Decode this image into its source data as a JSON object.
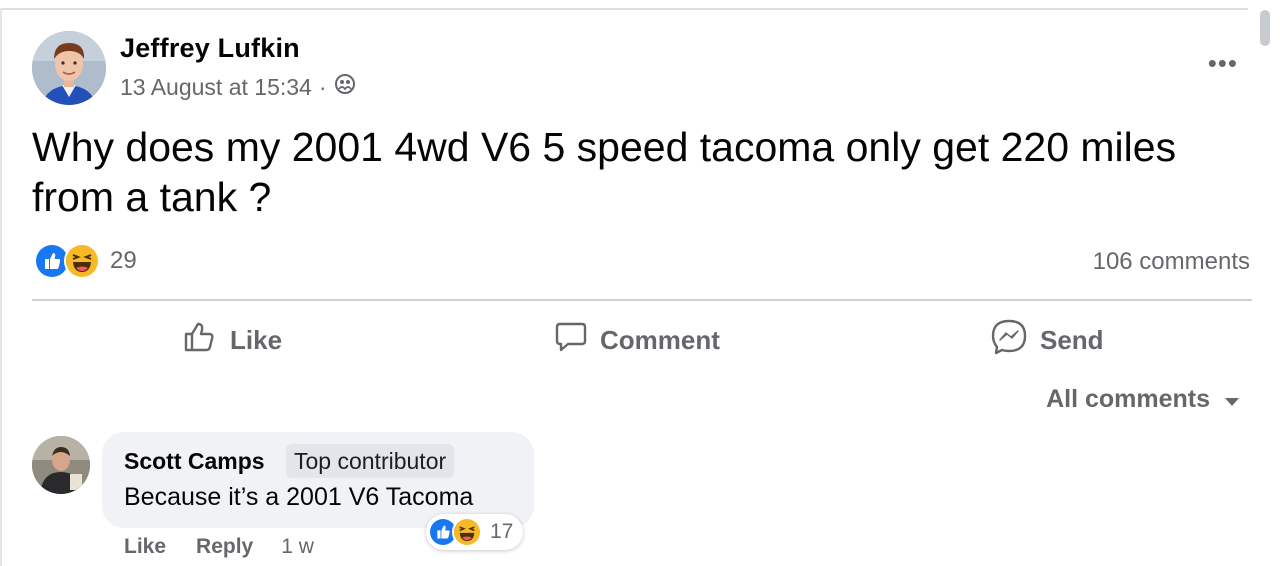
{
  "post": {
    "author": "Jeffrey Lufkin",
    "timestamp": "13 August at 15:34",
    "separator": "·",
    "audience_icon": "friends-audience-icon",
    "more_icon": "more-options-icon",
    "more_label": "•••",
    "text": "Why does my 2001 4wd V6 5 speed tacoma only get 220 miles from a tank ?",
    "reactions": {
      "types": [
        "like",
        "haha"
      ],
      "count": "29"
    },
    "comments_count": "106 comments"
  },
  "actions": {
    "like": {
      "label": "Like",
      "icon": "thumbs-up-icon"
    },
    "comment": {
      "label": "Comment",
      "icon": "comment-bubble-icon"
    },
    "send": {
      "label": "Send",
      "icon": "messenger-icon"
    }
  },
  "comments_filter": {
    "label": "All comments",
    "icon": "caret-down-icon"
  },
  "comments": [
    {
      "author": "Scott Camps",
      "badge": "Top contributor",
      "text": "Because it’s a 2001 V6 Tacoma",
      "reactions": {
        "types": [
          "like",
          "haha"
        ],
        "count": "17"
      },
      "like_label": "Like",
      "reply_label": "Reply",
      "time": "1 w"
    }
  ],
  "colors": {
    "like_blue": "#1877f2",
    "haha_yellow": "#f7b928",
    "secondary_text": "#65676b",
    "comment_bubble": "#f0f2f5"
  }
}
